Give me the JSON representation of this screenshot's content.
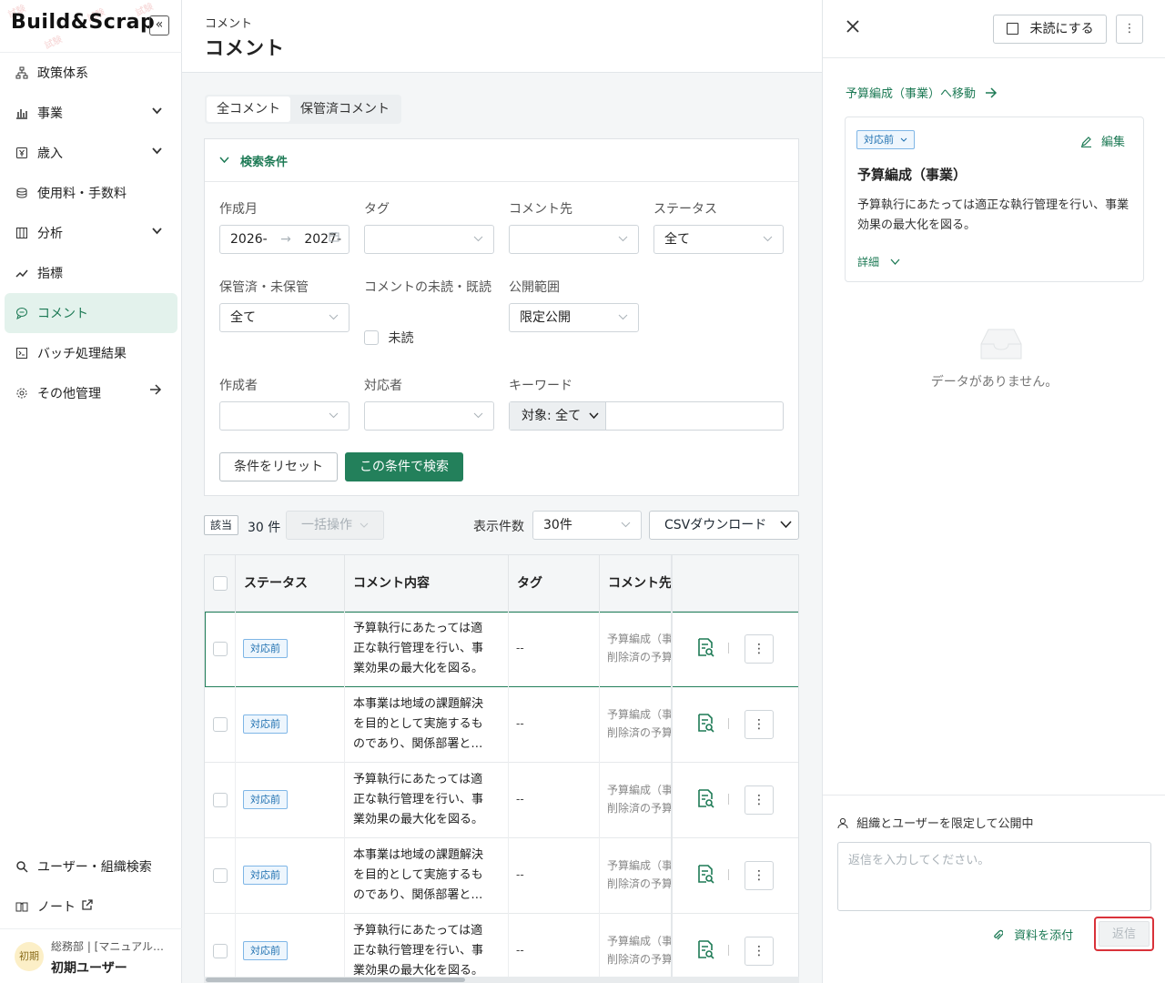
{
  "brand": {
    "logo": "Build&Scrap",
    "collapse_icon": "«"
  },
  "sidebar": {
    "items": [
      {
        "label": "政策体系"
      },
      {
        "label": "事業"
      },
      {
        "label": "歳入"
      },
      {
        "label": "使用料・手数料"
      },
      {
        "label": "分析"
      },
      {
        "label": "指標"
      },
      {
        "label": "コメント"
      },
      {
        "label": "バッチ処理結果"
      },
      {
        "label": "その他管理"
      }
    ],
    "bottom": [
      {
        "label": "ユーザー・組織検索"
      },
      {
        "label": "ノート"
      }
    ],
    "user": {
      "avatar": "初期",
      "org": "総務部 | [マニュアル…",
      "name": "初期ユーザー"
    }
  },
  "header": {
    "breadcrumb": "コメント",
    "title": "コメント"
  },
  "tabs": [
    "全コメント",
    "保管済コメント"
  ],
  "search": {
    "title": "検索条件",
    "fields": {
      "created_month": {
        "label": "作成月",
        "from": "2026-",
        "arrow": "→",
        "to": "2027-"
      },
      "tag": {
        "label": "タグ",
        "value": ""
      },
      "comment_target": {
        "label": "コメント先",
        "value": ""
      },
      "status": {
        "label": "ステータス",
        "value": "全て"
      },
      "archived": {
        "label": "保管済・未保管",
        "value": "全て"
      },
      "read_state": {
        "label": "コメントの未読・既読",
        "option": "未読"
      },
      "visibility": {
        "label": "公開範囲",
        "value": "限定公開"
      },
      "author": {
        "label": "作成者",
        "value": ""
      },
      "assignee": {
        "label": "対応者",
        "value": ""
      },
      "keyword": {
        "label": "キーワード",
        "scope": "対象: 全て",
        "value": ""
      }
    },
    "reset_label": "条件をリセット",
    "search_label": "この条件で検索"
  },
  "results": {
    "hit_label": "該当",
    "count": "30 件",
    "bulk_label": "一括操作",
    "per_page_label": "表示件数",
    "per_page": "30件",
    "csv_label": "CSVダウンロード"
  },
  "table": {
    "headers": [
      "ステータス",
      "コメント内容",
      "タグ",
      "コメント先"
    ],
    "rows": [
      {
        "status": "対応前",
        "content": "予算執行にあたっては適\n正な執行管理を行い、事\n業効果の最大化を図る。",
        "tag": "--",
        "target1": "予算編成（事業）",
        "target2": "削除済の予算"
      },
      {
        "status": "対応前",
        "content": "本事業は地域の課題解決\nを目的として実施するも\nのであり、関係部署と…",
        "tag": "--",
        "target1": "予算編成（事業）",
        "target2": "削除済の予算"
      },
      {
        "status": "対応前",
        "content": "予算執行にあたっては適\n正な執行管理を行い、事\n業効果の最大化を図る。",
        "tag": "--",
        "target1": "予算編成（事業）",
        "target2": "削除済の予算"
      },
      {
        "status": "対応前",
        "content": "本事業は地域の課題解決\nを目的として実施するも\nのであり、関係部署と…",
        "tag": "--",
        "target1": "予算編成（事業）",
        "target2": "削除済の予算"
      },
      {
        "status": "対応前",
        "content": "予算執行にあたっては適\n正な執行管理を行い、事\n業効果の最大化を図る。",
        "tag": "--",
        "target1": "予算編成（事業）",
        "target2": "削除済の予算"
      }
    ]
  },
  "panel": {
    "unread_label": "未読にする",
    "goto_label": "予算編成（事業）へ移動",
    "card": {
      "status": "対応前",
      "edit_label": "編集",
      "title": "予算編成（事業）",
      "body": "予算執行にあたっては適正な執行管理を行い、事業効果の最大化を図る。",
      "detail_label": "詳細"
    },
    "empty_text": "データがありません。",
    "scope_text": "組織とユーザーを限定して公開中",
    "reply_placeholder": "返信を入力してください。",
    "attach_label": "資料を添付",
    "send_label": "返信"
  },
  "colors": {
    "accent": "#23805b",
    "badge": "#1d6fb0",
    "highlight": "#d9323a"
  }
}
